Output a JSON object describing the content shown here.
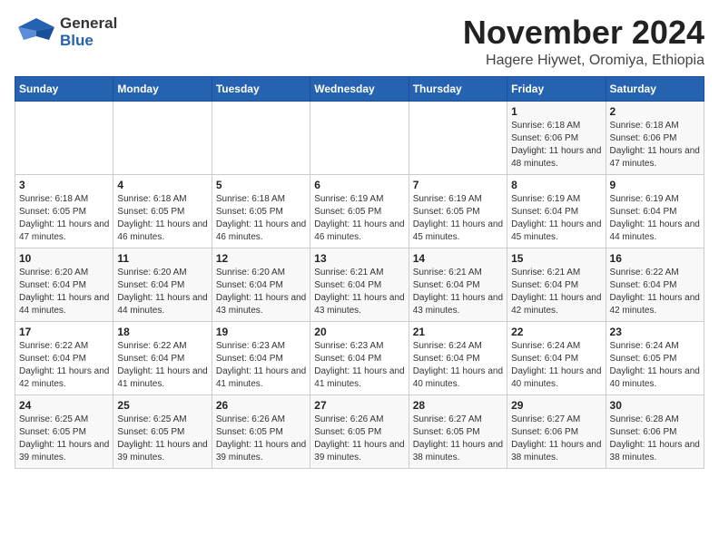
{
  "header": {
    "logo_general": "General",
    "logo_blue": "Blue",
    "month_title": "November 2024",
    "location": "Hagere Hiywet, Oromiya, Ethiopia"
  },
  "calendar": {
    "days_of_week": [
      "Sunday",
      "Monday",
      "Tuesday",
      "Wednesday",
      "Thursday",
      "Friday",
      "Saturday"
    ],
    "weeks": [
      [
        {
          "day": "",
          "info": ""
        },
        {
          "day": "",
          "info": ""
        },
        {
          "day": "",
          "info": ""
        },
        {
          "day": "",
          "info": ""
        },
        {
          "day": "",
          "info": ""
        },
        {
          "day": "1",
          "info": "Sunrise: 6:18 AM\nSunset: 6:06 PM\nDaylight: 11 hours and 48 minutes."
        },
        {
          "day": "2",
          "info": "Sunrise: 6:18 AM\nSunset: 6:06 PM\nDaylight: 11 hours and 47 minutes."
        }
      ],
      [
        {
          "day": "3",
          "info": "Sunrise: 6:18 AM\nSunset: 6:05 PM\nDaylight: 11 hours and 47 minutes."
        },
        {
          "day": "4",
          "info": "Sunrise: 6:18 AM\nSunset: 6:05 PM\nDaylight: 11 hours and 46 minutes."
        },
        {
          "day": "5",
          "info": "Sunrise: 6:18 AM\nSunset: 6:05 PM\nDaylight: 11 hours and 46 minutes."
        },
        {
          "day": "6",
          "info": "Sunrise: 6:19 AM\nSunset: 6:05 PM\nDaylight: 11 hours and 46 minutes."
        },
        {
          "day": "7",
          "info": "Sunrise: 6:19 AM\nSunset: 6:05 PM\nDaylight: 11 hours and 45 minutes."
        },
        {
          "day": "8",
          "info": "Sunrise: 6:19 AM\nSunset: 6:04 PM\nDaylight: 11 hours and 45 minutes."
        },
        {
          "day": "9",
          "info": "Sunrise: 6:19 AM\nSunset: 6:04 PM\nDaylight: 11 hours and 44 minutes."
        }
      ],
      [
        {
          "day": "10",
          "info": "Sunrise: 6:20 AM\nSunset: 6:04 PM\nDaylight: 11 hours and 44 minutes."
        },
        {
          "day": "11",
          "info": "Sunrise: 6:20 AM\nSunset: 6:04 PM\nDaylight: 11 hours and 44 minutes."
        },
        {
          "day": "12",
          "info": "Sunrise: 6:20 AM\nSunset: 6:04 PM\nDaylight: 11 hours and 43 minutes."
        },
        {
          "day": "13",
          "info": "Sunrise: 6:21 AM\nSunset: 6:04 PM\nDaylight: 11 hours and 43 minutes."
        },
        {
          "day": "14",
          "info": "Sunrise: 6:21 AM\nSunset: 6:04 PM\nDaylight: 11 hours and 43 minutes."
        },
        {
          "day": "15",
          "info": "Sunrise: 6:21 AM\nSunset: 6:04 PM\nDaylight: 11 hours and 42 minutes."
        },
        {
          "day": "16",
          "info": "Sunrise: 6:22 AM\nSunset: 6:04 PM\nDaylight: 11 hours and 42 minutes."
        }
      ],
      [
        {
          "day": "17",
          "info": "Sunrise: 6:22 AM\nSunset: 6:04 PM\nDaylight: 11 hours and 42 minutes."
        },
        {
          "day": "18",
          "info": "Sunrise: 6:22 AM\nSunset: 6:04 PM\nDaylight: 11 hours and 41 minutes."
        },
        {
          "day": "19",
          "info": "Sunrise: 6:23 AM\nSunset: 6:04 PM\nDaylight: 11 hours and 41 minutes."
        },
        {
          "day": "20",
          "info": "Sunrise: 6:23 AM\nSunset: 6:04 PM\nDaylight: 11 hours and 41 minutes."
        },
        {
          "day": "21",
          "info": "Sunrise: 6:24 AM\nSunset: 6:04 PM\nDaylight: 11 hours and 40 minutes."
        },
        {
          "day": "22",
          "info": "Sunrise: 6:24 AM\nSunset: 6:04 PM\nDaylight: 11 hours and 40 minutes."
        },
        {
          "day": "23",
          "info": "Sunrise: 6:24 AM\nSunset: 6:05 PM\nDaylight: 11 hours and 40 minutes."
        }
      ],
      [
        {
          "day": "24",
          "info": "Sunrise: 6:25 AM\nSunset: 6:05 PM\nDaylight: 11 hours and 39 minutes."
        },
        {
          "day": "25",
          "info": "Sunrise: 6:25 AM\nSunset: 6:05 PM\nDaylight: 11 hours and 39 minutes."
        },
        {
          "day": "26",
          "info": "Sunrise: 6:26 AM\nSunset: 6:05 PM\nDaylight: 11 hours and 39 minutes."
        },
        {
          "day": "27",
          "info": "Sunrise: 6:26 AM\nSunset: 6:05 PM\nDaylight: 11 hours and 39 minutes."
        },
        {
          "day": "28",
          "info": "Sunrise: 6:27 AM\nSunset: 6:05 PM\nDaylight: 11 hours and 38 minutes."
        },
        {
          "day": "29",
          "info": "Sunrise: 6:27 AM\nSunset: 6:06 PM\nDaylight: 11 hours and 38 minutes."
        },
        {
          "day": "30",
          "info": "Sunrise: 6:28 AM\nSunset: 6:06 PM\nDaylight: 11 hours and 38 minutes."
        }
      ]
    ]
  }
}
